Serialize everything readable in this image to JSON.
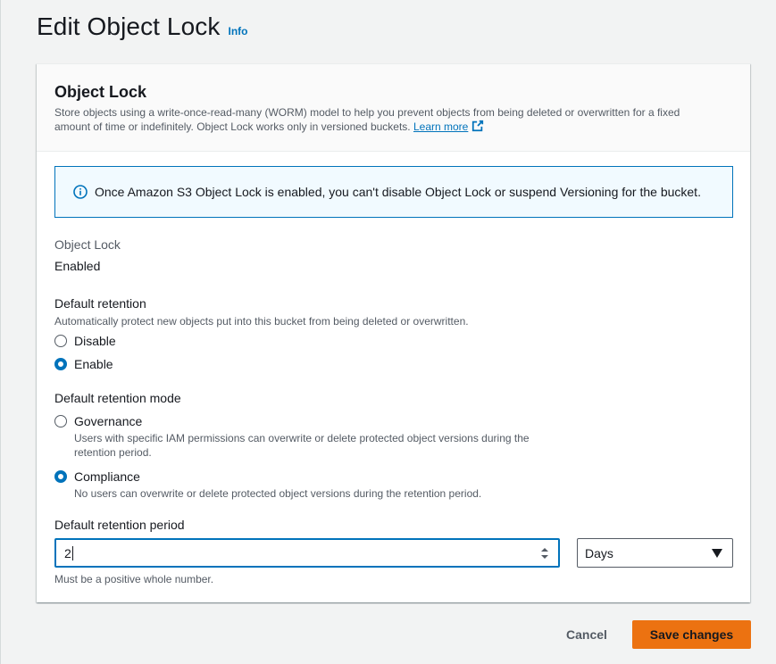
{
  "page": {
    "title": "Edit Object Lock",
    "info_link": "Info"
  },
  "panel": {
    "title": "Object Lock",
    "description": "Store objects using a write-once-read-many (WORM) model to help you prevent objects from being deleted or overwritten for a fixed amount of time or indefinitely. Object Lock works only in versioned buckets.",
    "learn_more": "Learn more"
  },
  "alert": {
    "icon": "info-icon",
    "text": "Once Amazon S3 Object Lock is enabled, you can't disable Object Lock or suspend Versioning for the bucket."
  },
  "object_lock": {
    "label": "Object Lock",
    "value": "Enabled"
  },
  "default_retention": {
    "label": "Default retention",
    "description": "Automatically protect new objects put into this bucket from being deleted or overwritten.",
    "options": [
      {
        "label": "Disable",
        "checked": false
      },
      {
        "label": "Enable",
        "checked": true
      }
    ]
  },
  "retention_mode": {
    "label": "Default retention mode",
    "options": [
      {
        "label": "Governance",
        "description": "Users with specific IAM permissions can overwrite or delete protected object versions during the retention period.",
        "checked": false
      },
      {
        "label": "Compliance",
        "description": "No users can overwrite or delete protected object versions during the retention period.",
        "checked": true
      }
    ]
  },
  "retention_period": {
    "label": "Default retention period",
    "value": "2",
    "unit": "Days",
    "constraint": "Must be a positive whole number."
  },
  "actions": {
    "cancel": "Cancel",
    "save": "Save changes"
  },
  "colors": {
    "accent": "#0073bb",
    "primary_button": "#ec7211"
  }
}
